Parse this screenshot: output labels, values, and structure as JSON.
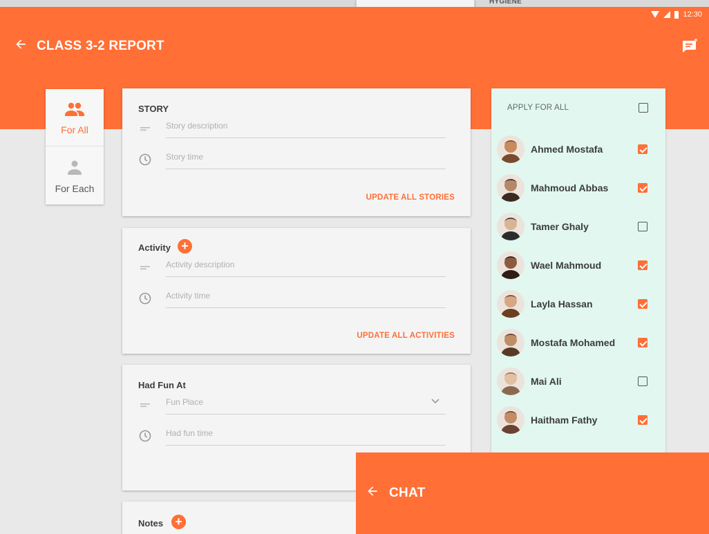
{
  "background": {
    "peek_text": "HYGIENE"
  },
  "status_bar": {
    "time": "12:30"
  },
  "header": {
    "back_icon": "arrow-left-icon",
    "title": "CLASS 3-2 REPORT",
    "chat_icon": "chat-bubble-icon"
  },
  "mode_tabs": [
    {
      "label": "For All",
      "icon": "group-icon",
      "active": true
    },
    {
      "label": "For Each",
      "icon": "person-icon",
      "active": false
    }
  ],
  "cards": {
    "story": {
      "title": "STORY",
      "description_placeholder": "Story description",
      "time_placeholder": "Story time",
      "action": "UPDATE ALL STORIES"
    },
    "activity": {
      "title": "Activity",
      "description_placeholder": "Activity description",
      "time_placeholder": "Activity time",
      "action": "UPDATE ALL ACTIVITIES"
    },
    "fun": {
      "title": "Had Fun At",
      "place_placeholder": "Fun Place",
      "time_placeholder": "Had fun time"
    },
    "notes": {
      "title": "Notes"
    }
  },
  "students_panel": {
    "apply_all_label": "APPLY FOR ALL",
    "apply_all_checked": false,
    "students": [
      {
        "name": "Ahmed Mostafa",
        "checked": true
      },
      {
        "name": "Mahmoud Abbas",
        "checked": true
      },
      {
        "name": "Tamer Ghaly",
        "checked": false
      },
      {
        "name": "Wael Mahmoud",
        "checked": true
      },
      {
        "name": "Layla Hassan",
        "checked": true
      },
      {
        "name": "Mostafa Mohamed",
        "checked": true
      },
      {
        "name": "Mai Ali",
        "checked": false
      },
      {
        "name": "Haitham Fathy",
        "checked": true
      }
    ]
  },
  "chat": {
    "back_icon": "arrow-left-icon",
    "title": "CHAT"
  },
  "colors": {
    "accent": "#ff6f36",
    "panel": "#e1f7f0",
    "card": "#f4f4f4",
    "background": "#e9e9e9"
  }
}
